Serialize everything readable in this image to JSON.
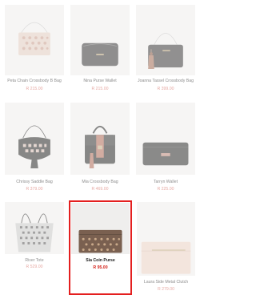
{
  "products": [
    {
      "name": "Peta Chain Crossbody B Bag",
      "price": "R 215.00"
    },
    {
      "name": "Nina Purse Wallet",
      "price": "R 215.00"
    },
    {
      "name": "Joanna Tassel Crossbody Bag",
      "price": "R 399.00"
    },
    {
      "name": "Chrissy Saddle Bag",
      "price": "R 379.00"
    },
    {
      "name": "Mia Crossbody Bag",
      "price": "R 469.00"
    },
    {
      "name": "Tarryn Wallet",
      "price": "R 225.00"
    },
    {
      "name": "River Tote",
      "price": "R 529.00"
    },
    {
      "name": "Sia Coin Purse",
      "price": "R 95.00"
    },
    {
      "name": "Laura Side Metal Clutch",
      "price": "R 279.00"
    }
  ],
  "colors": {
    "selected_border": "#e41f1f",
    "price": "#d3221a"
  }
}
